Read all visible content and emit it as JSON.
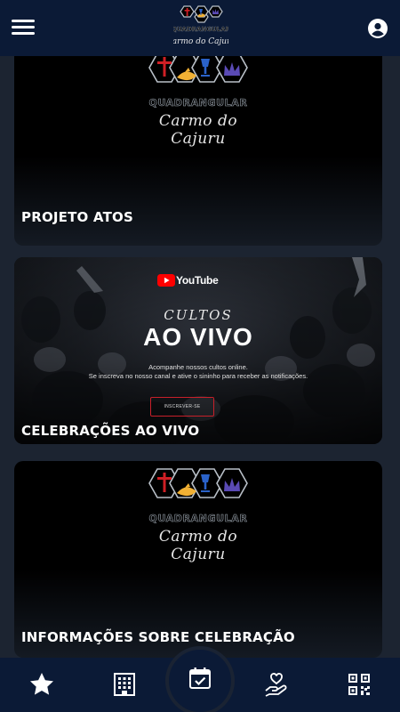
{
  "header": {
    "menu_icon": "hamburger-menu-icon",
    "logo_icon": "church-logo-icon",
    "profile_icon": "account-circle-icon"
  },
  "cards": [
    {
      "title": "PROJETO ATOS",
      "brand_name": "QUADRANGULAR",
      "brand_sub": "Carmo do Cajuru"
    },
    {
      "title": "CELEBRAÇÕES AO VIVO",
      "youtube_label": "YouTube",
      "cultos": "CULTOS",
      "ao_vivo": "AO VIVO",
      "desc_line1": "Acompanhe nossos cultos online.",
      "desc_line2": "Se inscreva no nosso canal e ative o sininho para receber as notificações.",
      "subscribe_label": "INSCREVER-SE"
    },
    {
      "title": "INFORMAÇÕES SOBRE CELEBRAÇÃO",
      "brand_name": "QUADRANGULAR",
      "brand_sub": "Carmo do Cajuru"
    }
  ],
  "bottom_nav": {
    "items": [
      "star-icon",
      "building-icon",
      "calendar-check-icon",
      "heart-hand-icon",
      "qr-code-icon"
    ],
    "active": "calendar-check-icon"
  },
  "colors": {
    "bar_background": "#0b1a36",
    "page_background": "#1c2431",
    "cross_red": "#d01f25",
    "dove_yellow": "#f2b134",
    "cup_blue": "#2a62c9",
    "crown_purple": "#5a4ab5",
    "youtube_red": "#ff0000"
  }
}
